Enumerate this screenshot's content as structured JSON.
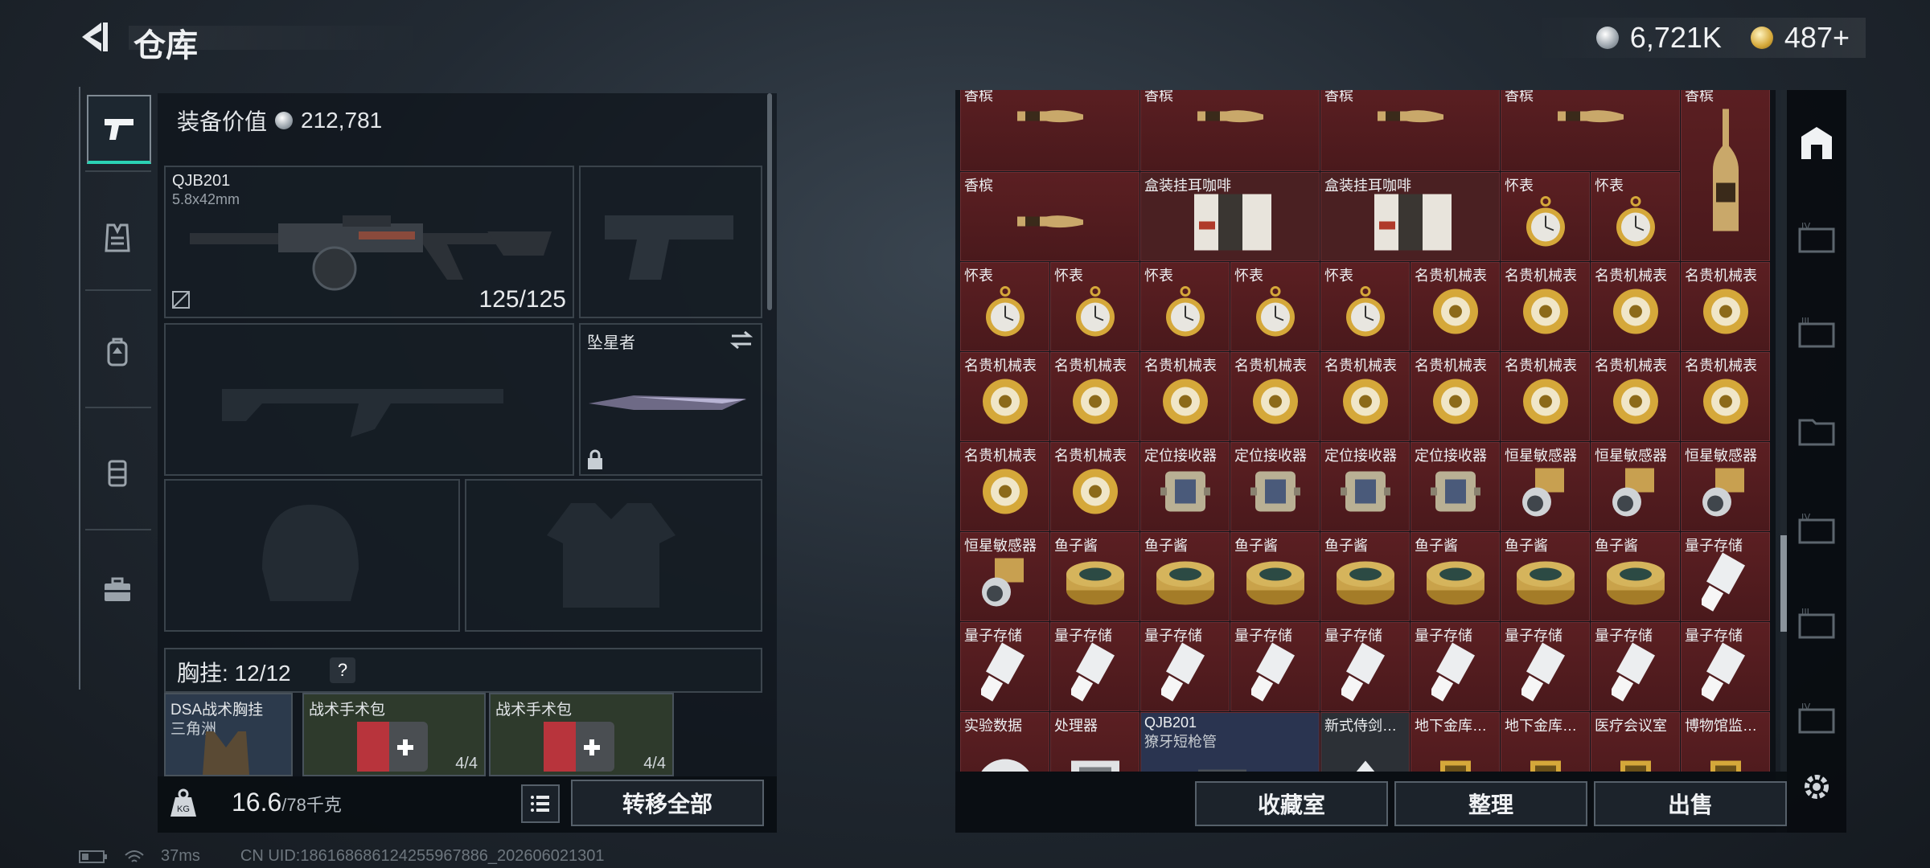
{
  "header": {
    "title": "仓库",
    "silver_value": "6,721K",
    "gold_value": "487+"
  },
  "equipment": {
    "value_label": "装备价值",
    "value": "212,781",
    "primary": {
      "name": "QJB201",
      "caliber": "5.8x42mm",
      "ammo": "125/125"
    },
    "melee": {
      "name": "坠星者"
    }
  },
  "vest": {
    "label": "胸挂: 12/12",
    "help": "?",
    "items": [
      {
        "label": "DSA战术胸挂",
        "sub": "三角洲"
      },
      {
        "label": "战术手术包",
        "count": "4/4"
      },
      {
        "label": "战术手术包",
        "count": "4/4"
      }
    ]
  },
  "footer_left": {
    "weight": "16.6",
    "weight_max": "/78千克",
    "transfer_all": "转移全部"
  },
  "status": {
    "ping": "37ms",
    "uid": "CN UID:186168686124255967886_202606021301"
  },
  "grid_labels": {
    "champagne": "香槟",
    "coffee": "盒装挂耳咖啡",
    "pocket_watch": "怀表",
    "luxury_watch": "名贵机械表",
    "locator": "定位接收器",
    "sensor": "恒星敏感器",
    "caviar": "鱼子酱",
    "quantum": "量子存储",
    "exp_data": "实验数据",
    "processor": "处理器",
    "qjb": "QJB201",
    "qjb_sub": "獠牙短枪管",
    "sword": "新式侍剑…",
    "vault1": "地下金库…",
    "vault2": "地下金库…",
    "medroom": "医疗会议室",
    "museum": "博物馆监…"
  },
  "footer_right": {
    "collection": "收藏室",
    "arrange": "整理",
    "sell": "出售"
  },
  "colors": {
    "accent_teal": "#2bd2b4",
    "cell_red": "#5b1f22",
    "gold": "#d5a83a"
  }
}
